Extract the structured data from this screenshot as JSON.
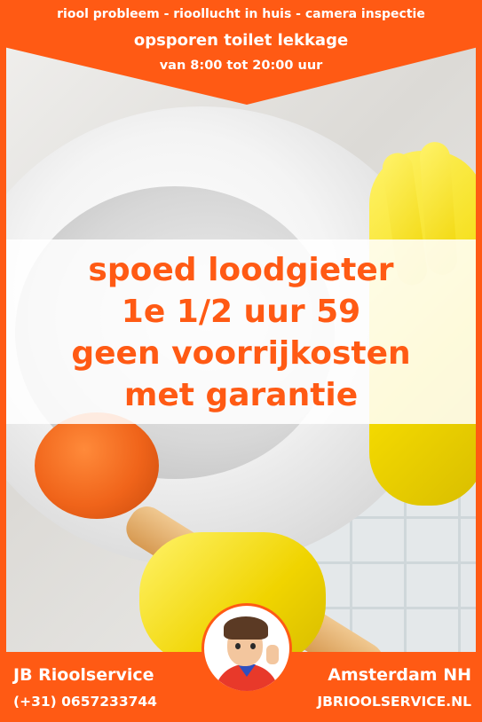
{
  "banner": {
    "line1": "riool probleem - rioollucht in huis - camera inspectie",
    "line2": "opsporen toilet lekkage",
    "line3": "van 8:00 tot 20:00 uur"
  },
  "headline": {
    "line1": "spoed loodgieter",
    "line2": "1e 1/2 uur 59",
    "line3": "geen voorrijkosten",
    "line4": "met garantie"
  },
  "footer": {
    "company": "JB Rioolservice",
    "phone": "(+31) 0657233744",
    "city": "Amsterdam NH",
    "website": "JBRIOOLSERVICE.NL"
  },
  "colors": {
    "accent": "#ff5a14",
    "text_light": "#ffffff",
    "glove": "#f2d800"
  },
  "icons": [
    "plumber-avatar"
  ]
}
